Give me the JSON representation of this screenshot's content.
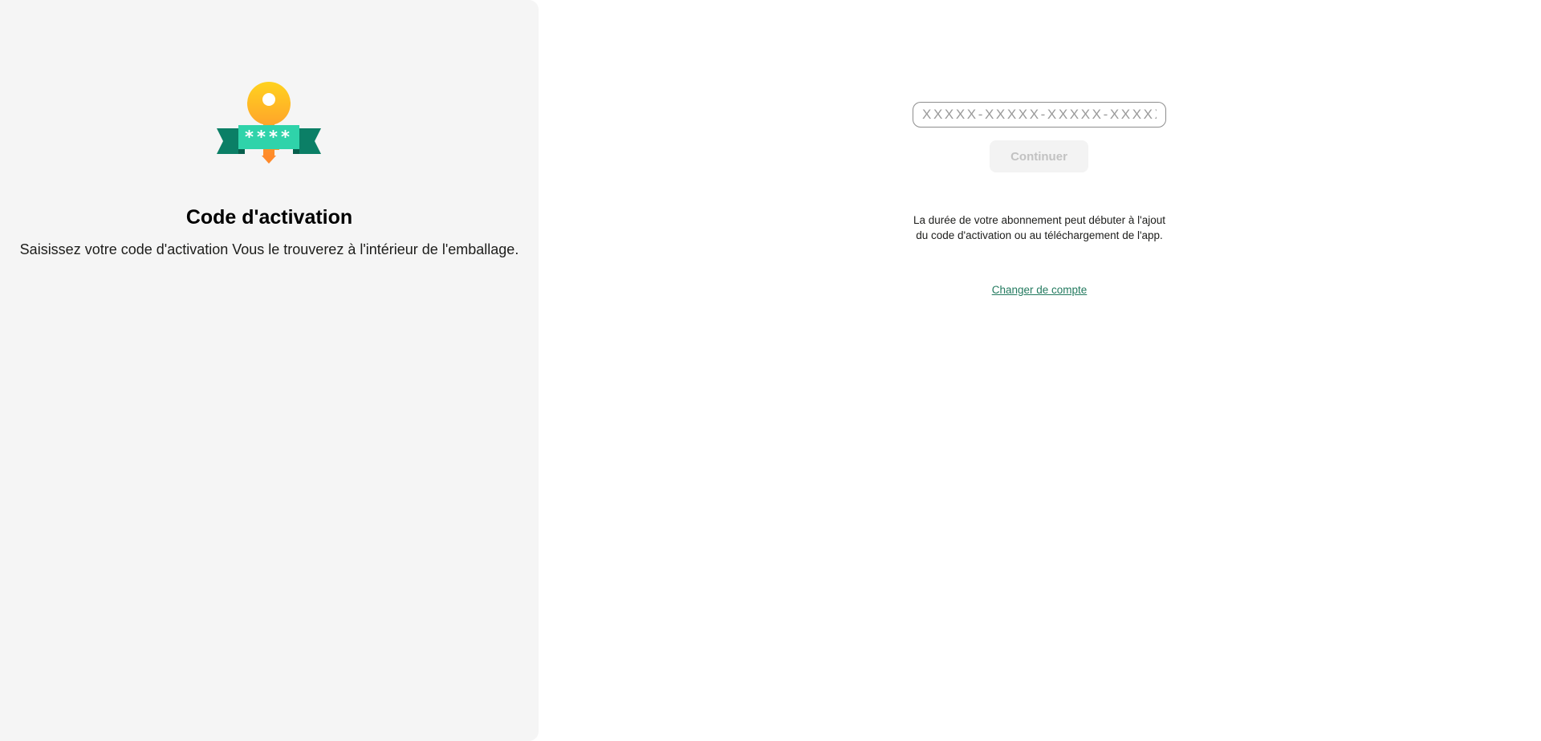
{
  "left_panel": {
    "title": "Code d'activation",
    "description": "Saisissez votre code d'activation Vous le trouverez à l'intérieur de l'emballage.",
    "illustration": {
      "icon": "activation-key-icon",
      "badge_text": "****"
    }
  },
  "form": {
    "code_input": {
      "placeholder": "XXXXX-XXXXX-XXXXX-XXXXX",
      "value": ""
    },
    "continue_label": "Continuer",
    "continue_enabled": false
  },
  "info_text": "La durée de votre abonnement peut débuter à l'ajout du code d'activation ou au téléchargement de l'app.",
  "switch_account_label": "Changer de compte",
  "colors": {
    "left_panel_bg": "#f5f5f5",
    "key_yellow": "#ffc21a",
    "key_orange": "#ff9a2b",
    "ribbon_light": "#2fd3aa",
    "ribbon_dark": "#0b7f66",
    "link": "#237a5f",
    "button_disabled_bg": "#f3f3f3",
    "button_disabled_text": "#c2c2c2"
  }
}
